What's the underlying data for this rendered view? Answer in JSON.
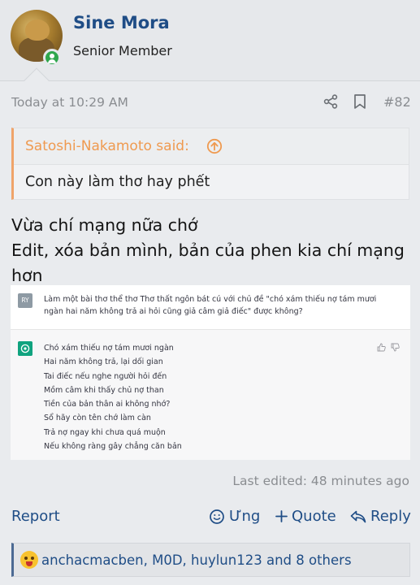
{
  "author": {
    "name": "Sine Mora",
    "title": "Senior Member"
  },
  "post": {
    "timestamp": "Today at 10:29 AM",
    "number": "#82",
    "quote": {
      "author": "Satoshi-Nakamoto said:",
      "text": "Con này làm thơ hay phết"
    },
    "body": [
      "Vừa chí mạng nữa chớ",
      "Edit, xóa bản mình, bản của phen kia chí mạng hơn"
    ],
    "embed": {
      "user_badge": "RY",
      "question": "Làm một bài thơ thể thơ Thơ thất ngôn bát cú với chủ đề \"chó xám thiếu nợ tám mươi ngàn hai năm không trả ai hỏi cũng giả câm giả điếc\" được không?",
      "poem": [
        "Chó xám thiếu nợ tám mươi ngàn",
        "Hai năm không trả, lại dối gian",
        "Tai điếc nếu nghe người hỏi đến",
        "Mồm câm khi thấy chủ nợ than",
        "Tiền của bản thân ai không nhớ?",
        "Sổ hãy còn tên chớ làm càn",
        "Trả nợ ngay khi chưa quá muộn",
        "Nếu không ràng gây chẳng căn bản"
      ]
    },
    "last_edited": "Last edited: 48 minutes ago"
  },
  "actions": {
    "report": "Report",
    "ung": "Ưng",
    "quote": "Quote",
    "reply": "Reply"
  },
  "reactions": {
    "text": "anchacmacben, M0D, huylun123 and 8 others"
  },
  "colors": {
    "link": "#1f4d86",
    "quote_accent": "#ef9a50",
    "online": "#2fa74d",
    "chatgpt": "#10a37f"
  }
}
